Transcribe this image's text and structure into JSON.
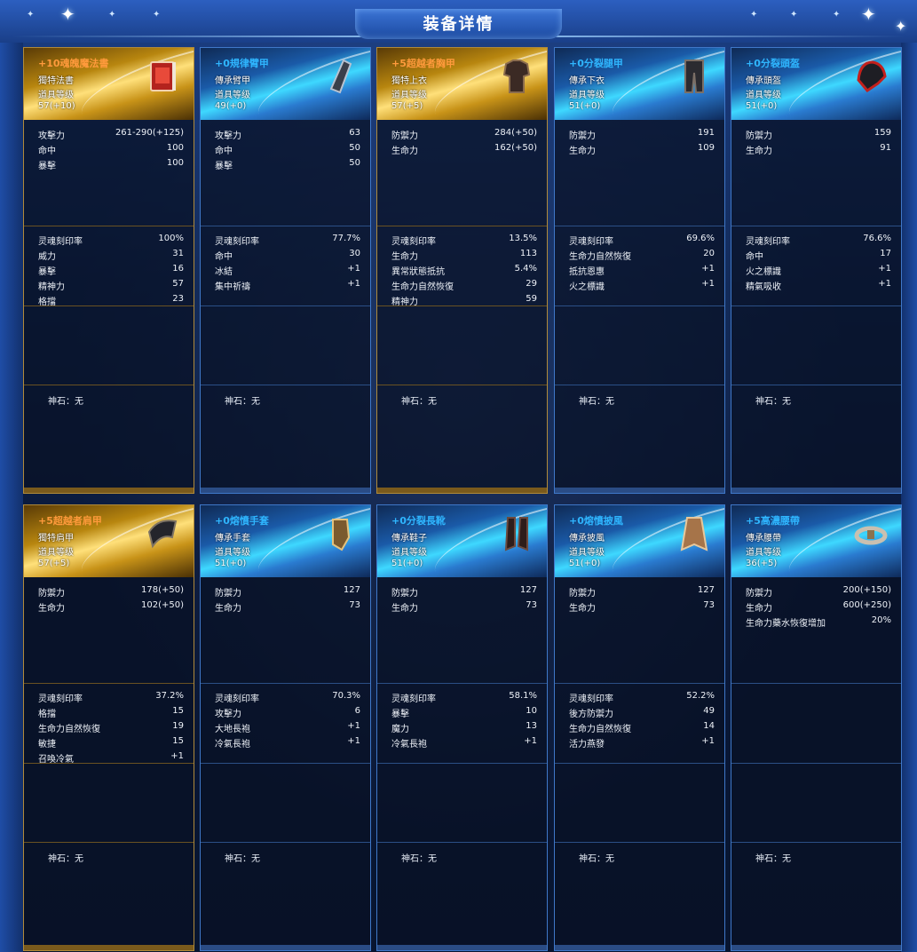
{
  "title": "装备详情",
  "stone_label": "神石：无",
  "cards": [
    {
      "name": "+10魂魄魔法書",
      "type": "獨特法書",
      "level_label": "道具等级",
      "level": "57(+10)",
      "tier": "gold",
      "icon": "spellbook-icon",
      "base": [
        [
          "攻擊力",
          "261-290(+125)"
        ],
        [
          "命中",
          "100"
        ],
        [
          "暴擊",
          "100"
        ]
      ],
      "extra": [
        [
          "灵魂刻印率",
          "100%"
        ],
        [
          "威力",
          "31"
        ],
        [
          "暴擊",
          "16"
        ],
        [
          "精神力",
          "57"
        ],
        [
          "格擋",
          "23"
        ]
      ]
    },
    {
      "name": "+0規律臂甲",
      "type": "傳承臂甲",
      "level_label": "道具等级",
      "level": "49(+0)",
      "tier": "blue",
      "icon": "bracer-icon",
      "base": [
        [
          "攻擊力",
          "63"
        ],
        [
          "命中",
          "50"
        ],
        [
          "暴擊",
          "50"
        ]
      ],
      "extra": [
        [
          "灵魂刻印率",
          "77.7%"
        ],
        [
          "命中",
          "30"
        ],
        [
          "冰結",
          "+1"
        ],
        [
          "集中祈禱",
          "+1"
        ]
      ]
    },
    {
      "name": "+5超越者胸甲",
      "type": "獨特上衣",
      "level_label": "道具等级",
      "level": "57(+5)",
      "tier": "gold",
      "icon": "chest-armor-icon",
      "base": [
        [
          "防禦力",
          "284(+50)"
        ],
        [
          "生命力",
          "162(+50)"
        ]
      ],
      "extra": [
        [
          "灵魂刻印率",
          "13.5%"
        ],
        [
          "生命力",
          "113"
        ],
        [
          "異常狀態抵抗",
          "5.4%"
        ],
        [
          "生命力自然恢復",
          "29"
        ],
        [
          "精神力",
          "59"
        ]
      ]
    },
    {
      "name": "+0分裂腿甲",
      "type": "傳承下衣",
      "level_label": "道具等级",
      "level": "51(+0)",
      "tier": "blue",
      "icon": "leg-armor-icon",
      "base": [
        [
          "防禦力",
          "191"
        ],
        [
          "生命力",
          "109"
        ]
      ],
      "extra": [
        [
          "灵魂刻印率",
          "69.6%"
        ],
        [
          "生命力自然恢復",
          "20"
        ],
        [
          "抵抗恩惠",
          "+1"
        ],
        [
          "火之標識",
          "+1"
        ]
      ]
    },
    {
      "name": "+0分裂頭盔",
      "type": "傳承頭盔",
      "level_label": "道具等级",
      "level": "51(+0)",
      "tier": "blue",
      "icon": "helmet-icon",
      "base": [
        [
          "防禦力",
          "159"
        ],
        [
          "生命力",
          "91"
        ]
      ],
      "extra": [
        [
          "灵魂刻印率",
          "76.6%"
        ],
        [
          "命中",
          "17"
        ],
        [
          "火之標識",
          "+1"
        ],
        [
          "精氣吸收",
          "+1"
        ]
      ]
    },
    {
      "name": "+5超越者肩甲",
      "type": "獨特肩甲",
      "level_label": "道具等级",
      "level": "57(+5)",
      "tier": "gold",
      "icon": "shoulder-armor-icon",
      "base": [
        [
          "防禦力",
          "178(+50)"
        ],
        [
          "生命力",
          "102(+50)"
        ]
      ],
      "extra": [
        [
          "灵魂刻印率",
          "37.2%"
        ],
        [
          "格擋",
          "15"
        ],
        [
          "生命力自然恢復",
          "19"
        ],
        [
          "敏捷",
          "15"
        ],
        [
          "召喚冷氣",
          "+1"
        ]
      ]
    },
    {
      "name": "+0熔憤手套",
      "type": "傳承手套",
      "level_label": "道具等级",
      "level": "51(+0)",
      "tier": "blue",
      "icon": "gloves-icon",
      "base": [
        [
          "防禦力",
          "127"
        ],
        [
          "生命力",
          "73"
        ]
      ],
      "extra": [
        [
          "灵魂刻印率",
          "70.3%"
        ],
        [
          "攻擊力",
          "6"
        ],
        [
          "大地長袍",
          "+1"
        ],
        [
          "冷氣長袍",
          "+1"
        ]
      ]
    },
    {
      "name": "+0分裂長靴",
      "type": "傳承鞋子",
      "level_label": "道具等级",
      "level": "51(+0)",
      "tier": "blue",
      "icon": "boots-icon",
      "base": [
        [
          "防禦力",
          "127"
        ],
        [
          "生命力",
          "73"
        ]
      ],
      "extra": [
        [
          "灵魂刻印率",
          "58.1%"
        ],
        [
          "暴擊",
          "10"
        ],
        [
          "魔力",
          "13"
        ],
        [
          "冷氣長袍",
          "+1"
        ]
      ]
    },
    {
      "name": "+0熔憤披風",
      "type": "傳承披風",
      "level_label": "道具等级",
      "level": "51(+0)",
      "tier": "blue",
      "icon": "cloak-icon",
      "base": [
        [
          "防禦力",
          "127"
        ],
        [
          "生命力",
          "73"
        ]
      ],
      "extra": [
        [
          "灵魂刻印率",
          "52.2%"
        ],
        [
          "後方防禦力",
          "49"
        ],
        [
          "生命力自然恢復",
          "14"
        ],
        [
          "活力燕發",
          "+1"
        ]
      ]
    },
    {
      "name": "+5高濃腰帶",
      "type": "傳承腰帶",
      "level_label": "道具等级",
      "level": "36(+5)",
      "tier": "blue",
      "icon": "belt-icon",
      "base": [
        [
          "防禦力",
          "200(+150)"
        ],
        [
          "生命力",
          "600(+250)"
        ],
        [
          "生命力藥水恢復增加",
          "20%"
        ]
      ],
      "extra": []
    }
  ]
}
